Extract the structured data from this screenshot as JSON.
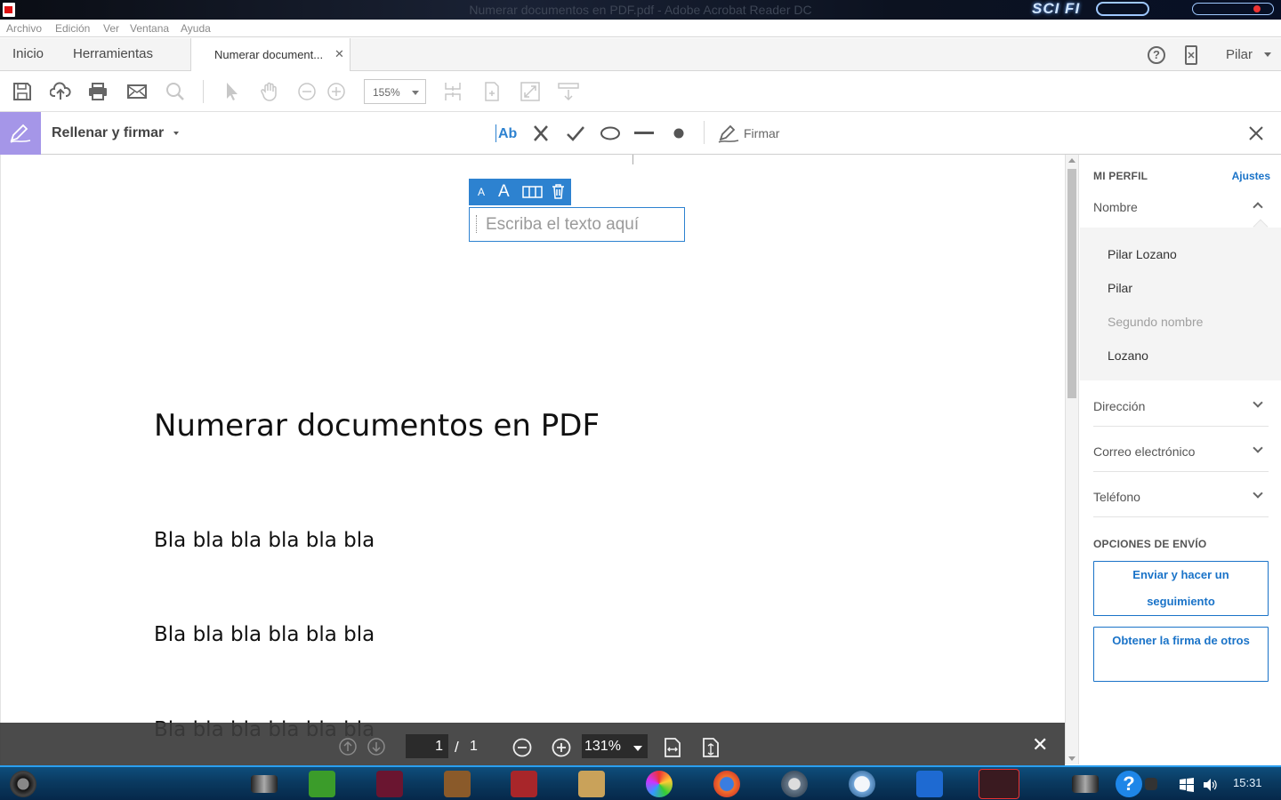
{
  "window": {
    "title": "Numerar documentos en PDF.pdf - Adobe Acrobat Reader DC",
    "brand": "SCI FI"
  },
  "menu": [
    "Archivo",
    "Edición",
    "Ver",
    "Ventana",
    "Ayuda"
  ],
  "tabs": {
    "home": "Inicio",
    "tools": "Herramientas",
    "document": "Numerar document...",
    "user": "Pilar"
  },
  "toolbar": {
    "zoom": "155%"
  },
  "fill_sign": {
    "title": "Rellenar y firmar",
    "text_tool": "Ab",
    "sign_label": "Firmar"
  },
  "document": {
    "field_placeholder": "Escriba el texto aquí",
    "field_small_a": "A",
    "field_large_a": "A",
    "heading": "Numerar documentos en PDF",
    "paragraphs": [
      "Bla bla bla bla bla bla",
      "Bla bla bla bla bla bla",
      "Bla bla bla bla bla bla"
    ]
  },
  "page_nav": {
    "current_page": "1",
    "separator": "/",
    "total_pages": "1",
    "zoom": "131%"
  },
  "profile": {
    "heading": "MI PERFIL",
    "settings_link": "Ajustes",
    "name_label": "Nombre",
    "names": [
      "Pilar Lozano",
      "Pilar",
      "Segundo nombre",
      "Lozano"
    ],
    "address": "Dirección",
    "email": "Correo electrónico",
    "phone": "Teléfono"
  },
  "send_options": {
    "heading": "OPCIONES DE ENVÍO",
    "send_track": "Enviar y hacer un seguimiento",
    "get_signatures": "Obtener la firma de otros"
  },
  "taskbar": {
    "clock": "15:31"
  },
  "colors": {
    "accent_blue": "#1a73c8",
    "fill_sign_purple": "#a596e8",
    "field_blue": "#2d82d0"
  }
}
